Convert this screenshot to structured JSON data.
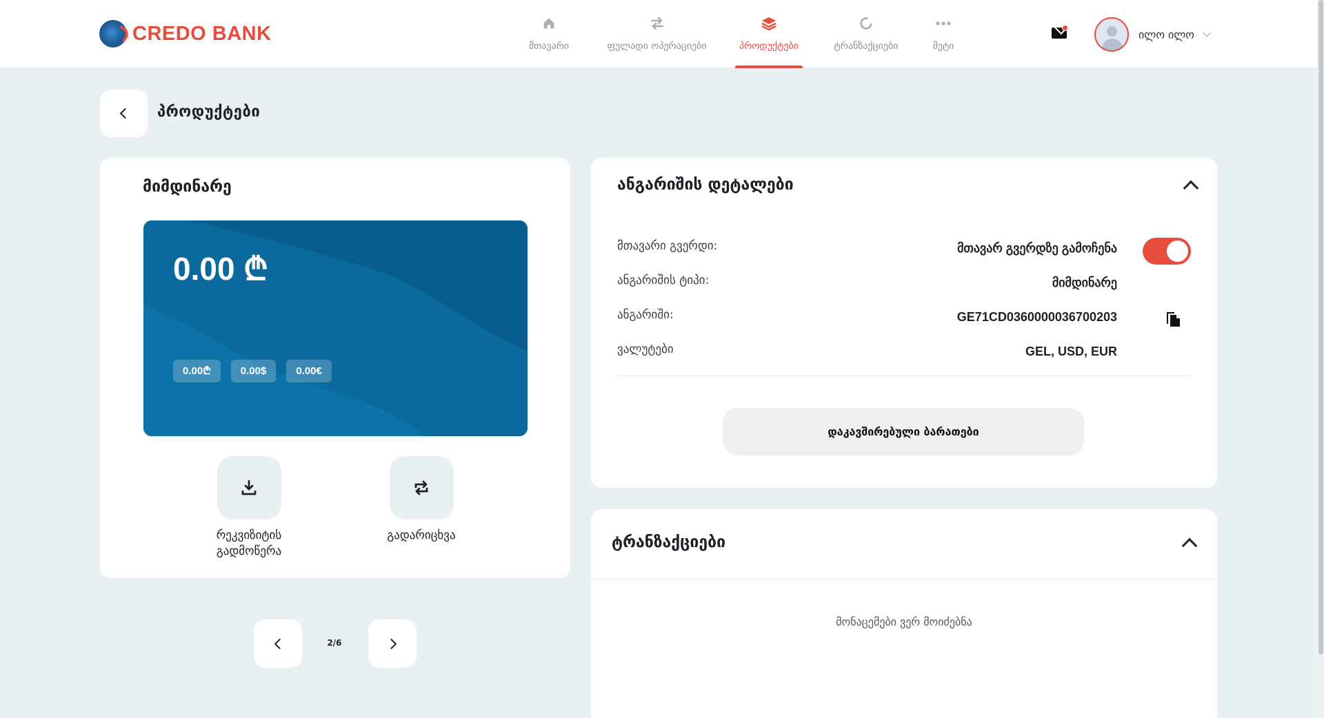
{
  "brand": {
    "name": "CREDO BANK",
    "accent": "#e84c3d",
    "card_blue": "#0a6a9e"
  },
  "nav": {
    "items": [
      {
        "label": "მთავარი",
        "icon": "home-icon"
      },
      {
        "label": "ფულადი ოპერაციები",
        "icon": "transfer-arrows-icon"
      },
      {
        "label": "პროდუქტები",
        "icon": "layers-icon",
        "active": true
      },
      {
        "label": "ტრანზაქციები",
        "icon": "history-icon"
      },
      {
        "label": "მეტი",
        "icon": "more-dots-icon"
      }
    ]
  },
  "header": {
    "mail_icon": "mail-icon",
    "user_name": "ილო ილო"
  },
  "page": {
    "title": "პროდუქტები"
  },
  "account_card": {
    "title": "მიმდინარე",
    "balance": "0.00 ₾",
    "chips": [
      "0.00₾",
      "0.00$",
      "0.00€"
    ],
    "actions": [
      {
        "label": "რეკვიზიტის გადმოწერა",
        "icon": "download-icon"
      },
      {
        "label": "გადარიცხვა",
        "icon": "refresh-transfer-icon"
      }
    ]
  },
  "pager": {
    "text": "2/6"
  },
  "details": {
    "title": "ანგარიშის დეტალები",
    "rows": [
      {
        "label": "მთავარი გვერდი:",
        "value": "მთავარ გვერდზე გამოჩენა",
        "toggle_on": true
      },
      {
        "label": "ანგარიშის ტიპი:",
        "value": "მიმდინარე"
      },
      {
        "label": "ანგარიში:",
        "value": "GE71CD0360000036700203"
      },
      {
        "label": "ვალუტები",
        "value": "GEL,  USD,  EUR"
      }
    ],
    "linked_cards_button": "დაკავშირებული ბარათები"
  },
  "transactions": {
    "title": "ტრანზაქციები",
    "empty_text": "მონაცემები ვერ მოიძებნა"
  }
}
